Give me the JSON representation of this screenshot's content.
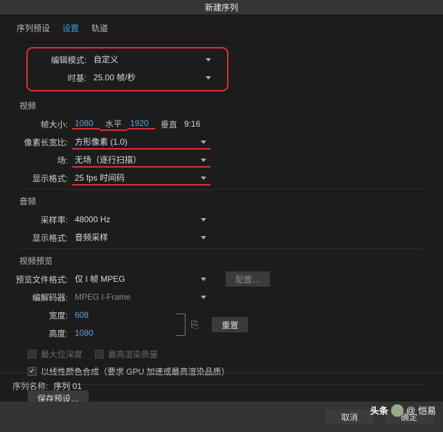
{
  "window": {
    "title": "新建序列"
  },
  "tabs": {
    "t1": "序列预设",
    "t2": "设置",
    "t3": "轨道"
  },
  "labels": {
    "editMode": "编辑模式:",
    "timebase": "时基:",
    "video": "视频",
    "frameSize": "帧大小:",
    "horiz": "水平",
    "vert": "垂直",
    "aspect": "9:16",
    "pixelAspect": "像素长宽比:",
    "fields": "场:",
    "displayFmt": "显示格式:",
    "audio": "音频",
    "sampleRate": "采样率:",
    "displayFmt2": "显示格式:",
    "videoPreview": "视频预览",
    "previewFmt": "预览文件格式:",
    "codec": "编解码器:",
    "width": "宽度:",
    "height": "高度:",
    "maxDepth": "最大位深度",
    "maxQuality": "最高渲染质量",
    "linearComp": "以线性颜色合成（要求 GPU 加速或最高渲染品质）",
    "savePreset": "保存预设…",
    "seqName": "序列名称:",
    "config": "配置…",
    "reset": "重置",
    "ok": "确定",
    "cancel": "取消"
  },
  "values": {
    "editMode": "自定义",
    "timebase": "25.00 帧/秒",
    "frameW": "1080",
    "frameH": "1920",
    "pixelAspect": "方形像素 (1.0)",
    "fields": "无场（逐行扫描）",
    "displayFmt": "25 fps 时间码",
    "sampleRate": "48000 Hz",
    "audioDisplay": "音频采样",
    "previewFmt": "仅 I 帧 MPEG",
    "codec": "MPEG I-Frame",
    "prevW": "608",
    "prevH": "1080",
    "seqName": "序列 01"
  },
  "watermark": {
    "brand": "头条",
    "at": "@",
    "name": "恺易"
  }
}
